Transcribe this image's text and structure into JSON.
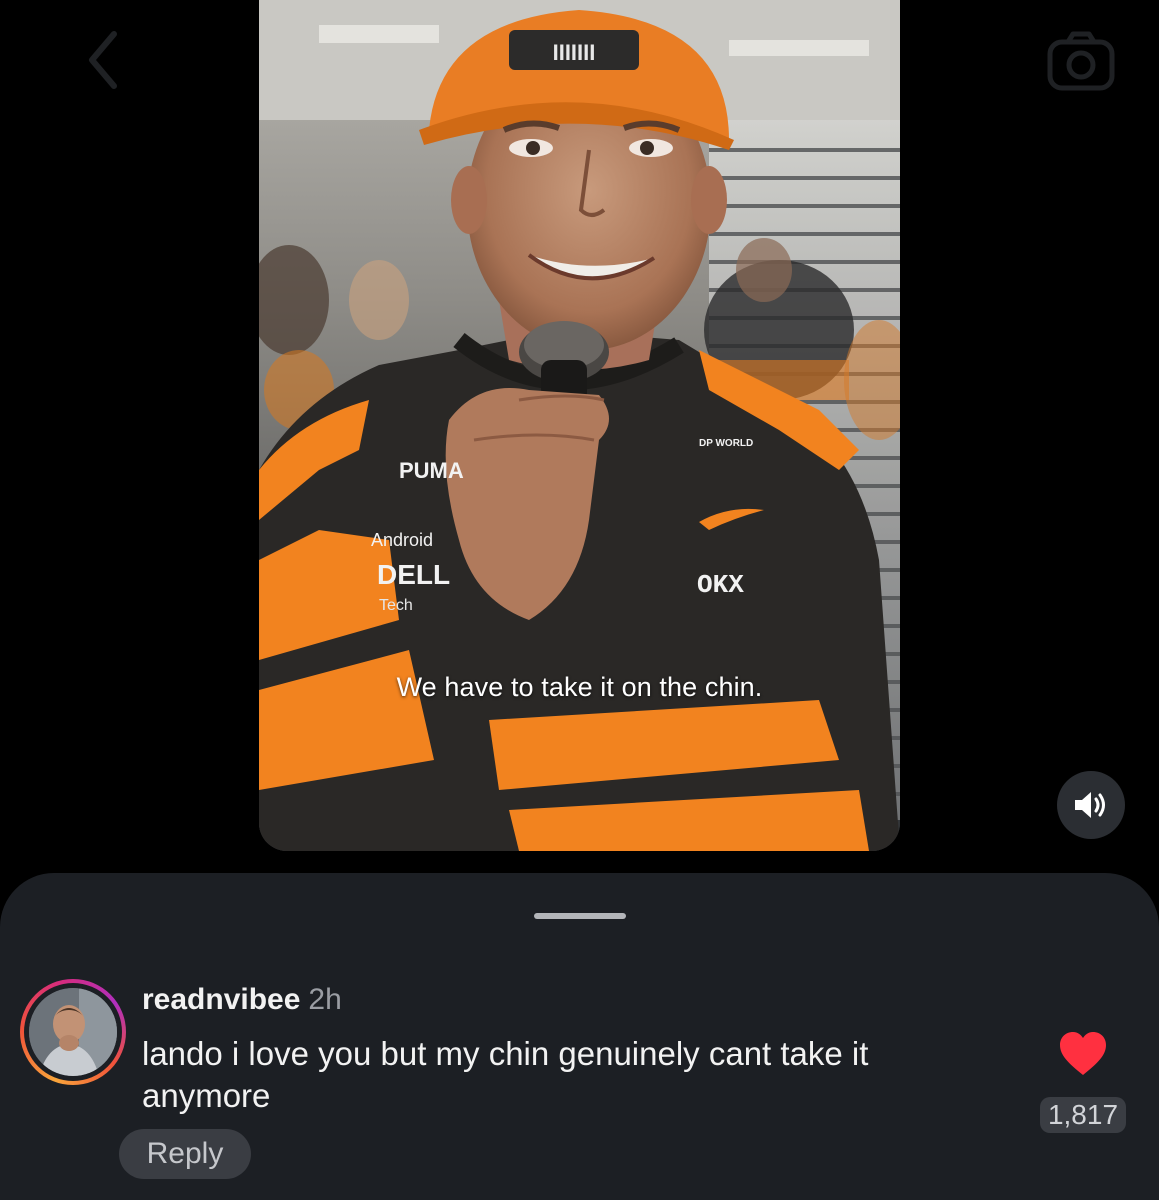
{
  "topbar": {
    "back_icon": "chevron-left-icon",
    "camera_icon": "camera-icon"
  },
  "video": {
    "caption": "We have to take it on the chin.",
    "cap_badge_text": "IIIIIII",
    "logo_puma": "PUMA",
    "logo_android": "Android",
    "logo_dell": "DELL",
    "logo_dell_sub": "Tech",
    "logo_dpworld": "DP WORLD",
    "logo_okx": "OKX",
    "sound_icon": "speaker-on-icon",
    "colors": {
      "papaya": "#f2831f",
      "hoodie": "#2a2826"
    }
  },
  "comment": {
    "username": "readnvibee",
    "time": "2h",
    "text": "lando i love you but my chin genuinely cant take it anymore",
    "like_count": "1,817",
    "liked": true,
    "reply_label": "Reply",
    "heart_color": "#ff3040"
  }
}
